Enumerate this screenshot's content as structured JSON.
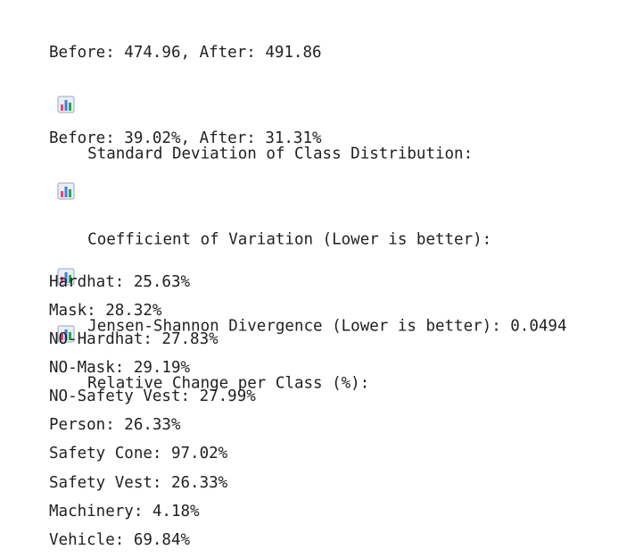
{
  "icons": {
    "chart": "bar-chart-icon"
  },
  "sections": {
    "std_dev": {
      "heading": "Standard Deviation of Class Distribution:",
      "detail": "Before: 474.96, After: 491.86"
    },
    "cv": {
      "heading": "Coefficient of Variation (Lower is better):",
      "detail": "Before: 39.02%, After: 31.31%"
    },
    "js": {
      "heading": "Jensen-Shannon Divergence (Lower is better): 0.0494"
    },
    "relative_change": {
      "heading": "Relative Change per Class (%):",
      "items": [
        "Hardhat: 25.63%",
        "Mask: 28.32%",
        "NO-Hardhat: 27.83%",
        "NO-Mask: 29.19%",
        "NO-Safety Vest: 27.99%",
        "Person: 26.33%",
        "Safety Cone: 97.02%",
        "Safety Vest: 26.33%",
        "Machinery: 4.18%",
        "Vehicle: 69.84%"
      ]
    }
  }
}
